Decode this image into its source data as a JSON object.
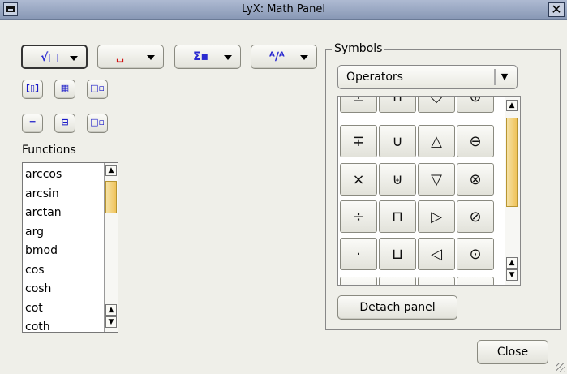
{
  "window": {
    "title": "LyX: Math Panel"
  },
  "toolbar": {
    "buttons": [
      {
        "icon": "√□",
        "name": "root"
      },
      {
        "icon": "␣",
        "name": "space"
      },
      {
        "icon": "Σ▪",
        "name": "big-operators"
      },
      {
        "icon": "ᴬ∕ᴬ",
        "name": "styles"
      }
    ]
  },
  "small_buttons": [
    {
      "icon": "[▯]",
      "name": "delimiters"
    },
    {
      "icon": "▦",
      "name": "matrix"
    },
    {
      "icon": "□▫",
      "name": "subscript"
    },
    {
      "icon": "═",
      "name": "equation"
    },
    {
      "icon": "⊟",
      "name": "fraction"
    },
    {
      "icon": "□▫",
      "name": "superscript"
    }
  ],
  "functions": {
    "label": "Functions",
    "items": [
      "arccos",
      "arcsin",
      "arctan",
      "arg",
      "bmod",
      "cos",
      "cosh",
      "cot",
      "coth"
    ]
  },
  "symbols": {
    "label": "Symbols",
    "category": "Operators",
    "rows": [
      [
        "±",
        "∩",
        "◇",
        "⊕"
      ],
      [
        "∓",
        "∪",
        "△",
        "⊖"
      ],
      [
        "×",
        "⊎",
        "▽",
        "⊗"
      ],
      [
        "÷",
        "⊓",
        "▷",
        "⊘"
      ],
      [
        "·",
        "⊔",
        "◁",
        "⊙"
      ],
      [
        "",
        "",
        "",
        "◯"
      ]
    ]
  },
  "detach_button": "Detach panel",
  "close_button": "Close"
}
